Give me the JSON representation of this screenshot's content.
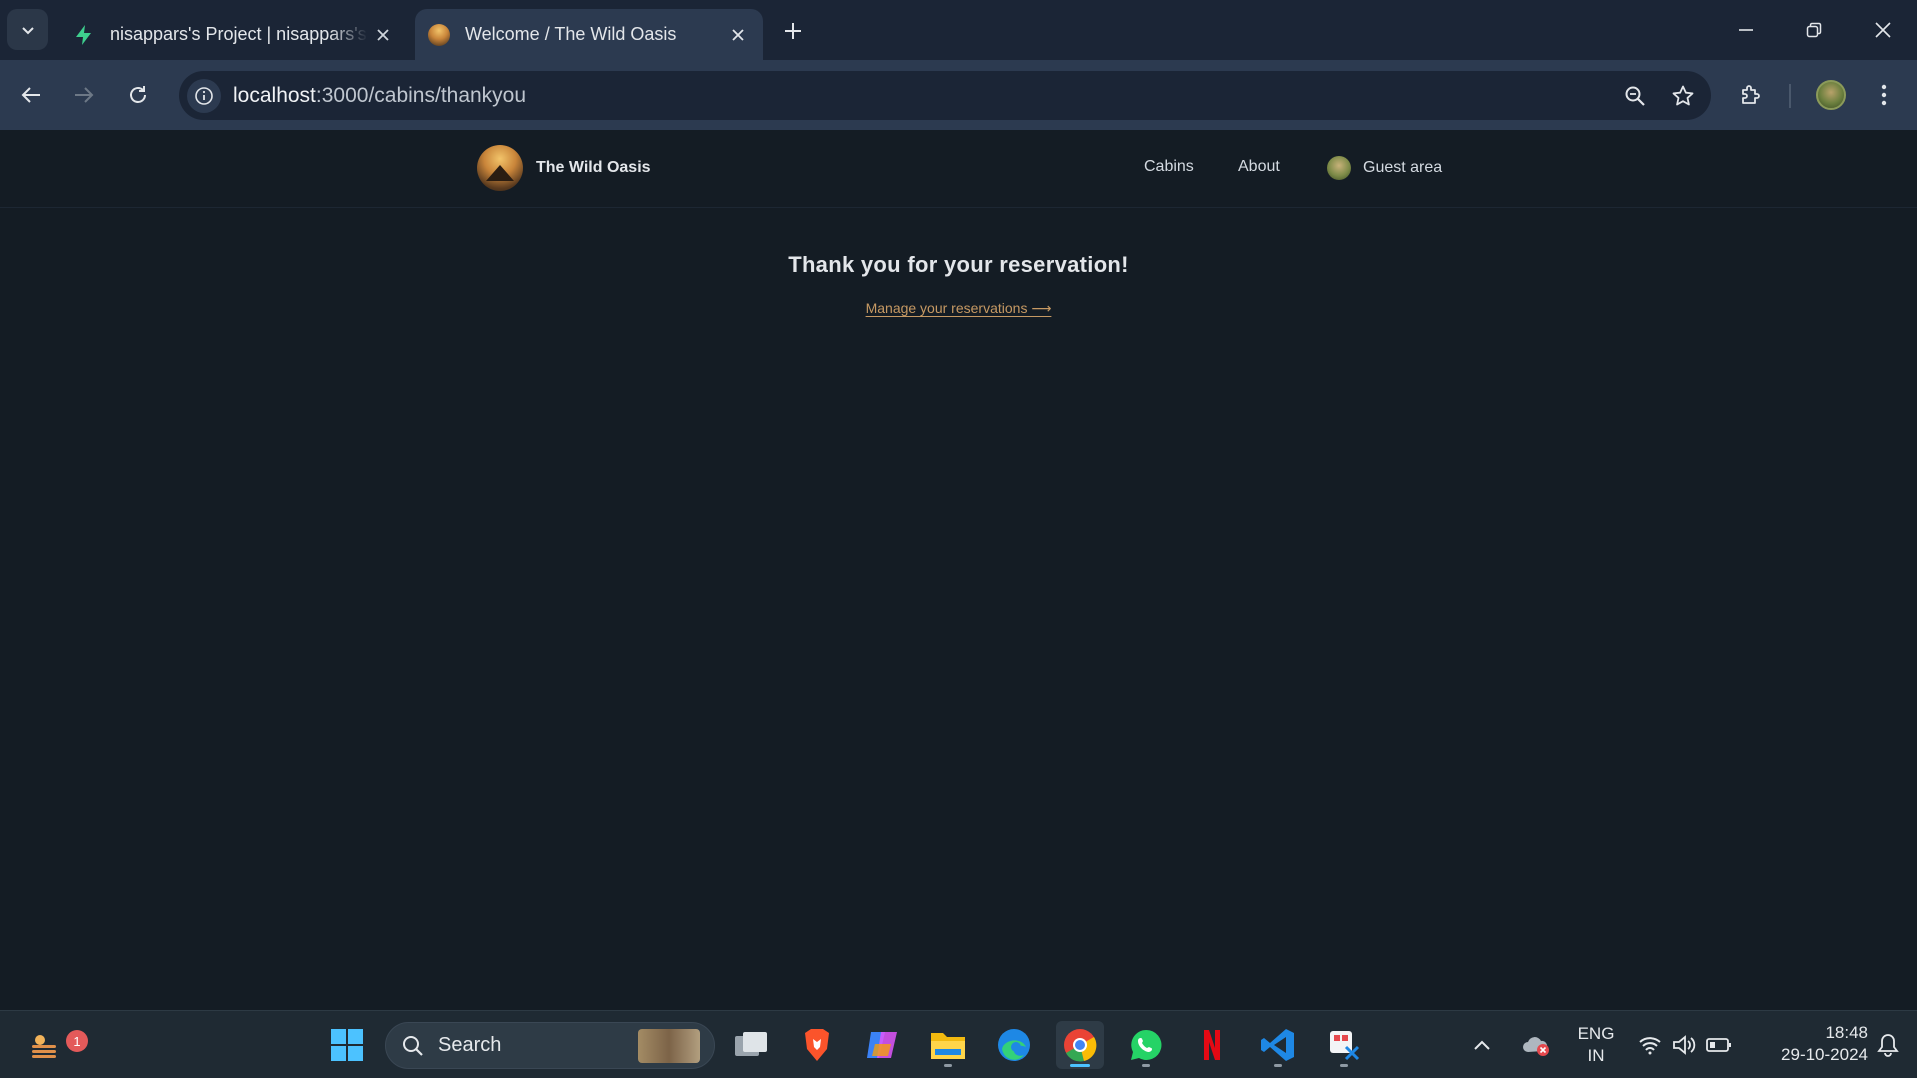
{
  "browser": {
    "tabs": [
      {
        "title": "nisappars's Project | nisappars's",
        "favicon": "supabase-bolt-icon",
        "active": false
      },
      {
        "title": "Welcome / The Wild Oasis",
        "favicon": "wild-oasis-logo-icon",
        "active": true
      }
    ],
    "url_host": "localhost",
    "url_path": ":3000/cabins/thankyou"
  },
  "site": {
    "brand": "The Wild Oasis",
    "nav": {
      "cabins": "Cabins",
      "about": "About",
      "guest_area": "Guest area"
    }
  },
  "main": {
    "heading": "Thank you for your reservation!",
    "manage_link": "Manage your reservations ⟶"
  },
  "taskbar": {
    "search_label": "Search",
    "notification_count": "1",
    "language_line1": "ENG",
    "language_line2": "IN",
    "time": "18:48",
    "date": "29-10-2024"
  },
  "colors": {
    "page_background": "#141c24",
    "accent_link": "#c69963",
    "browser_frame": "#1b2536",
    "toolbar": "#2c3a50",
    "taskbar": "#1f2a33"
  }
}
